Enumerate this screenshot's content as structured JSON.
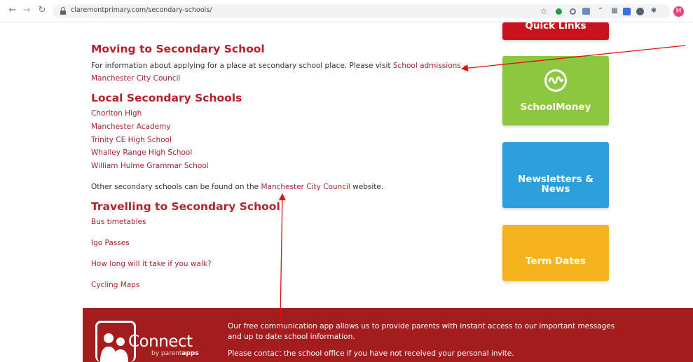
{
  "browser": {
    "url": "claremontprimary.com/secondary-schools/",
    "profile_initial": "M"
  },
  "sections": {
    "moving": {
      "heading": "Moving to Secondary School",
      "text": "For information about applying for a place at secondary school place. Please visit",
      "link_part1": "School admissions –",
      "link_part2": "Manchester City Council"
    },
    "local": {
      "heading": "Local Secondary Schools",
      "schools": [
        "Chorlton High",
        "Manchester Academy",
        "Trinity CE High School",
        "Whalley Range High School",
        "William Hulme Grammar School"
      ],
      "other_text_before": "Other secondary schools can be found on the",
      "other_link": "Manchester City Council",
      "other_text_after": "website."
    },
    "travelling": {
      "heading": "Travelling to Secondary School",
      "links": [
        "Bus timetables",
        "Igo Passes",
        "How long will it take if you walk?",
        "Cycling Maps"
      ]
    }
  },
  "tiles": {
    "quick_links": "Quick Links",
    "school_money": "SchoolMoney",
    "newsletters_line1": "Newsletters &",
    "newsletters_line2": "News",
    "term_dates": "Term Dates"
  },
  "footer": {
    "logo_word": "Connect",
    "logo_by": "by parent",
    "logo_apps": "apps",
    "text_line1": "Our free communication app allows us to provide parents with instant access to our important messages",
    "text_line2": "and up to date school information.",
    "text_line3": "Please contact the school office if you have not received your personal invite."
  },
  "colors": {
    "heading_red": "#b5222e",
    "tile_red": "#c8121d",
    "tile_green": "#8dc63f",
    "tile_blue": "#2c9fdc",
    "tile_orange": "#f5b41e",
    "footer_red": "#a31c1e"
  }
}
